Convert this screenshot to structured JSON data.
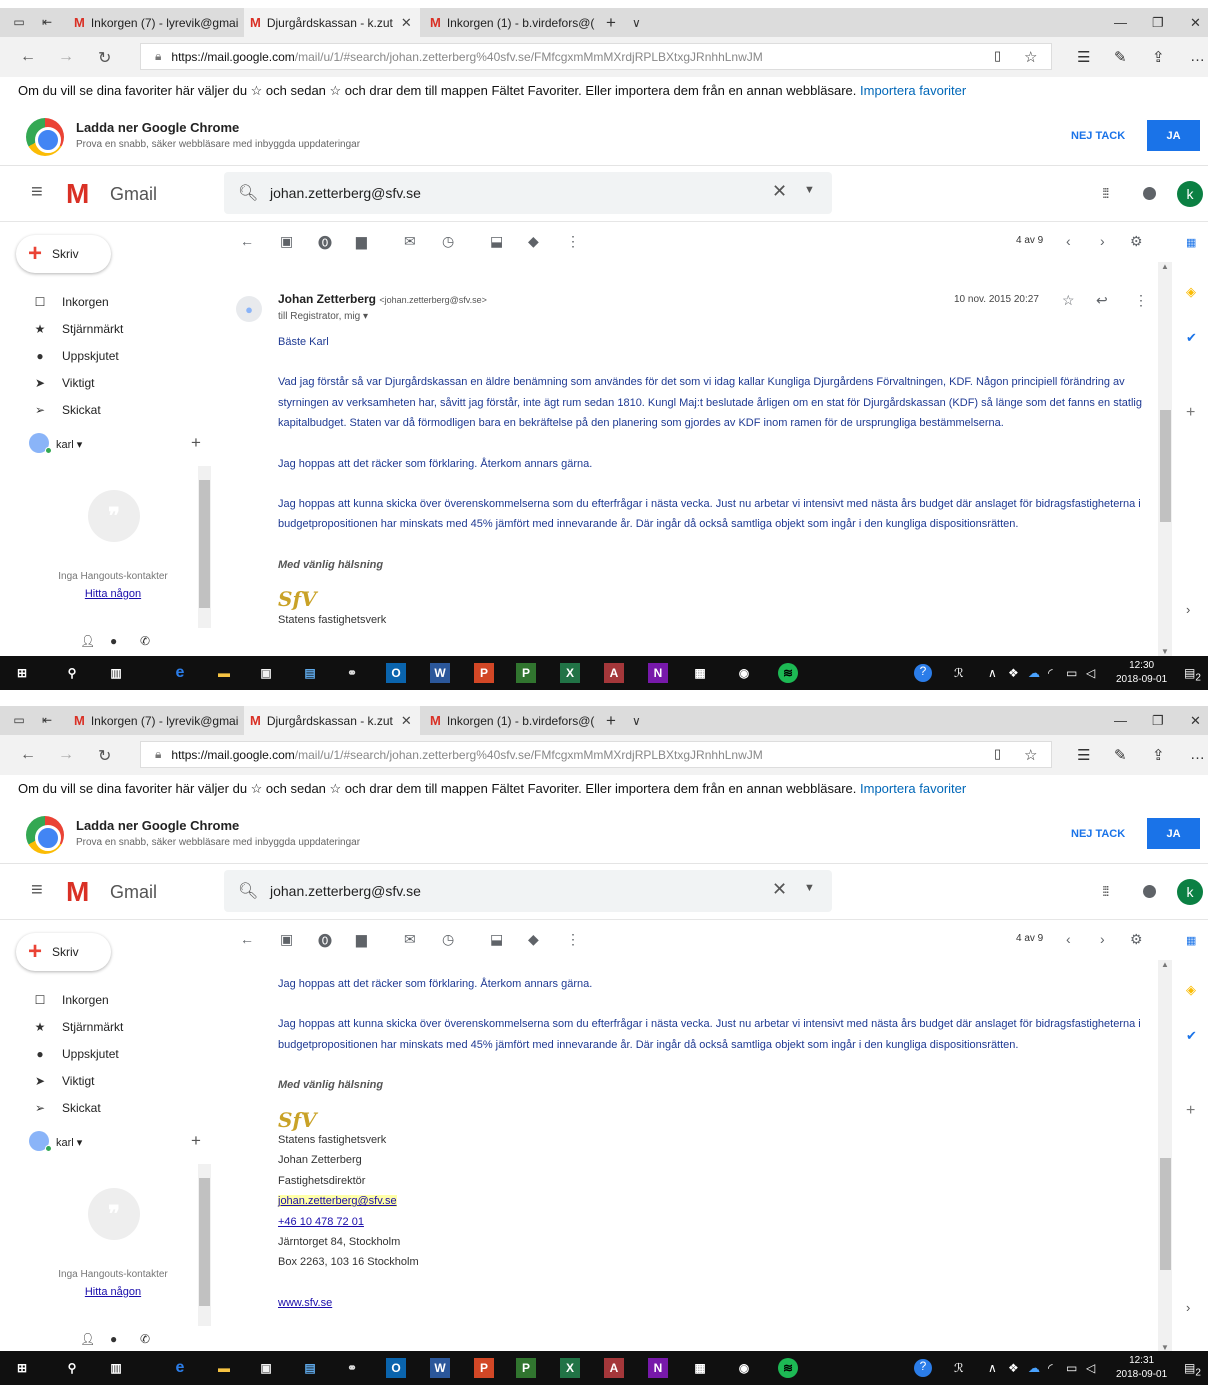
{
  "browser": {
    "tabs": [
      {
        "label": "Inkorgen (7) - lyrevik@gmai"
      },
      {
        "label": "Djurgårdskassan - k.zut"
      },
      {
        "label": "Inkorgen (1) - b.virdefors@("
      }
    ],
    "url_host": "https://mail.google.com",
    "url_path": "/mail/u/1/#search/johan.zetterberg%40sfv.se/FMfcgxmMmMXrdjRPLBXtxgJRnhhLnwJM",
    "favbar_text": "Om du vill se dina favoriter här väljer du ☆ och sedan ☆ och drar dem till mappen Fältet Favoriter. Eller importera dem från en annan webbläsare.",
    "favbar_link": "Importera favoriter"
  },
  "chrome_promo": {
    "title": "Ladda ner Google Chrome",
    "subtitle": "Prova en snabb, säker webbläsare med inbyggda uppdateringar",
    "decline": "NEJ TACK",
    "accept": "JA"
  },
  "gmail": {
    "logo_text": "Gmail",
    "search_value": "johan.zetterberg@sfv.se",
    "avatar_letter": "k",
    "compose_label": "Skriv",
    "nav": [
      {
        "label": "Inkorgen"
      },
      {
        "label": "Stjärnmärkt"
      },
      {
        "label": "Uppskjutet"
      },
      {
        "label": "Viktigt"
      },
      {
        "label": "Skickat"
      }
    ],
    "hangouts_user": "karl",
    "hangouts_none": "Inga Hangouts-kontakter",
    "hangouts_find": "Hitta någon",
    "pager": "4 av 9"
  },
  "message": {
    "sender_name": "Johan Zetterberg",
    "sender_email": "<johan.zetterberg@sfv.se>",
    "recipients": "till Registrator, mig",
    "date": "10 nov. 2015 20:27",
    "greeting": "Bäste Karl",
    "para1": "Vad jag förstår så var Djurgårdskassan en äldre benämning som användes för det som vi idag kallar Kungliga Djurgårdens Förvaltningen, KDF. Någon principiell förändring av styrningen av verksamheten har, såvitt jag förstår, inte ägt rum sedan 1810. Kungl Maj:t beslutade årligen om en stat för Djurgårdskassan (KDF) så länge som det fanns en statlig kapitalbudget. Staten var då förmodligen bara en bekräftelse på den planering som gjordes av KDF inom ramen för de ursprungliga bestämmelserna.",
    "para2": "Jag hoppas att det räcker som förklaring. Återkom annars gärna.",
    "para3": "Jag hoppas att kunna skicka över överenskommelserna som du efterfrågar i nästa vecka. Just nu arbetar vi intensivt med nästa års budget där anslaget för bidragsfastigheterna i budgetpropositionen har minskats med 45% jämfört med innevarande år. Där ingår då också samtliga objekt som ingår i den kungliga dispositionsrätten.",
    "closing": "Med vänlig hälsning",
    "logo_text": "SfV",
    "sig_org": "Statens fastighetsverk",
    "sig_org_partial": "Statens fastighetsverk",
    "sig_name": "Johan Zetterberg",
    "sig_title": "Fastighetsdirektör",
    "sig_email": "johan.zetterberg@sfv.se",
    "sig_phone": "+46 10 478 72 01",
    "sig_address": "Järntorget 84, Stockholm",
    "sig_box": "Box 2263, 103 16 Stockholm",
    "sig_web": "www.sfv.se"
  },
  "taskbar": {
    "shot1_time": "12:30",
    "shot2_time": "12:31",
    "date": "2018-09-01",
    "notif_count": "2"
  },
  "colors": {
    "gmail_red": "#d93025",
    "link_blue": "#1a73e8",
    "body_text": "#1f3a93"
  }
}
